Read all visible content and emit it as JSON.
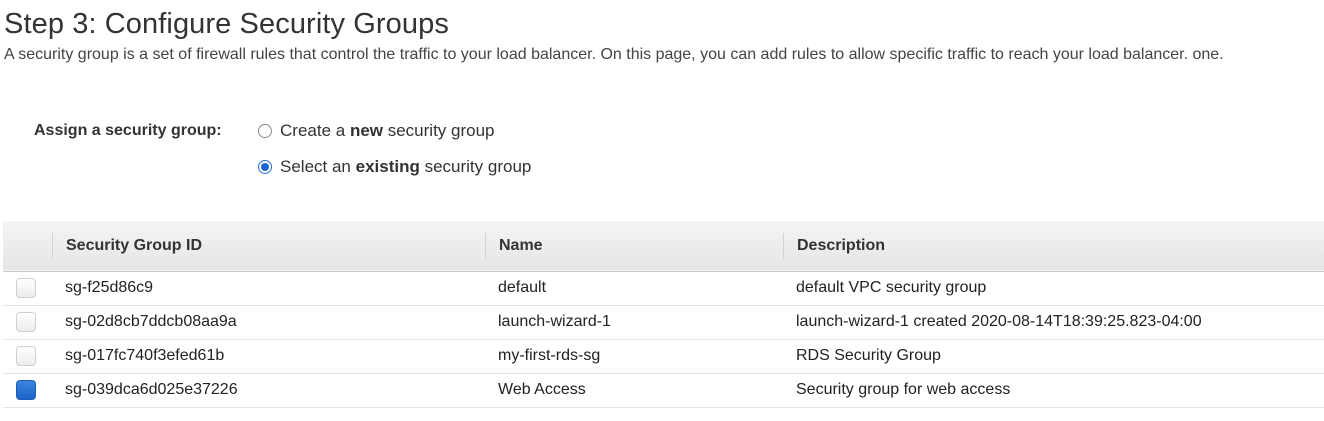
{
  "page": {
    "title": "Step 3: Configure Security Groups",
    "description": "A security group is a set of firewall rules that control the traffic to your load balancer. On this page, you can add rules to allow specific traffic to reach your load balancer. one."
  },
  "assign": {
    "label": "Assign a security group:",
    "options": [
      {
        "pre": "Create a ",
        "bold": "new",
        "post": " security group",
        "selected": false
      },
      {
        "pre": "Select an ",
        "bold": "existing",
        "post": " security group",
        "selected": true
      }
    ]
  },
  "table": {
    "columns": [
      "Security Group ID",
      "Name",
      "Description"
    ],
    "rows": [
      {
        "id": "sg-f25d86c9",
        "name": "default",
        "description": "default VPC security group",
        "checked": false
      },
      {
        "id": "sg-02d8cb7ddcb08aa9a",
        "name": "launch-wizard-1",
        "description": "launch-wizard-1 created 2020-08-14T18:39:25.823-04:00",
        "checked": false
      },
      {
        "id": "sg-017fc740f3efed61b",
        "name": "my-first-rds-sg",
        "description": "RDS Security Group",
        "checked": false
      },
      {
        "id": "sg-039dca6d025e37226",
        "name": "Web Access",
        "description": "Security group for web access",
        "checked": true
      }
    ]
  },
  "colors": {
    "accent": "#1b63c6"
  }
}
